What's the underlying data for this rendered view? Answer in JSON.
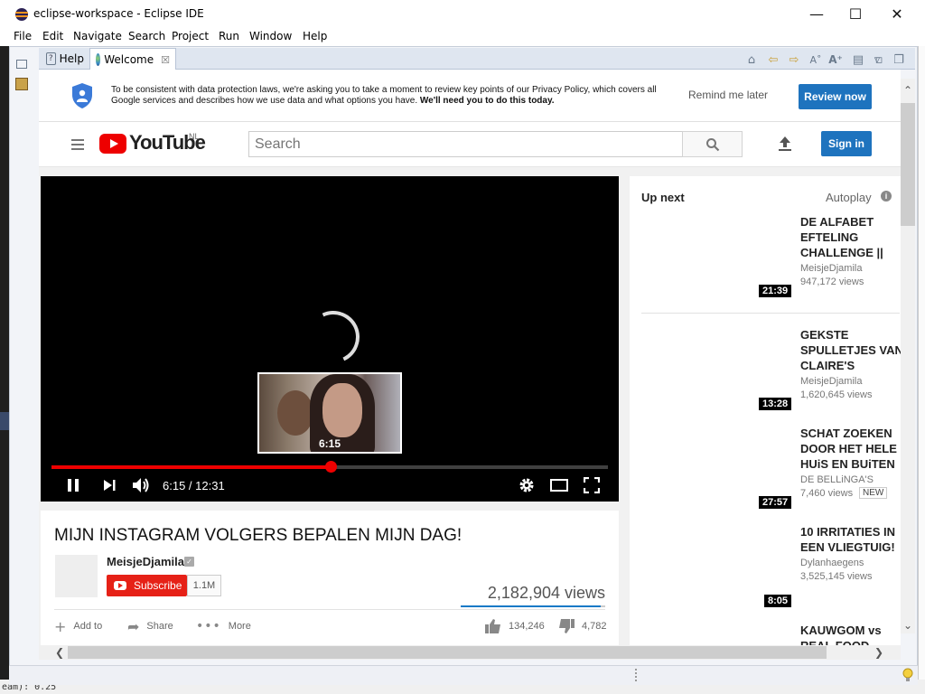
{
  "window": {
    "title": "eclipse-workspace - Eclipse IDE",
    "minimize": "—",
    "maximize": "☐",
    "close": "✕"
  },
  "menu": [
    "File",
    "Edit",
    "Navigate",
    "Search",
    "Project",
    "Run",
    "Window",
    "Help"
  ],
  "tabs": {
    "help": "Help",
    "welcome": "Welcome",
    "welcome_close": "☒"
  },
  "banner": {
    "text_plain": "To be consistent with data protection laws, we're asking you to take a moment to review key points of our Privacy Policy, which covers all Google services and describes how we use data and what options you have.",
    "text_bold": "We'll need you to do this today.",
    "remind": "Remind me later",
    "review": "Review now"
  },
  "header": {
    "logo_text": "YouTube",
    "region": "NL",
    "search_placeholder": "Search",
    "sign_in": "Sign in"
  },
  "player": {
    "preview_time": "6:15",
    "time_display": "6:15 / 12:31",
    "progress_fraction": 0.502
  },
  "video": {
    "title": "MIJN INSTAGRAM VOLGERS BEPALEN MIJN DAG!",
    "channel": "MeisjeDjamila",
    "subscribe": "Subscribe",
    "subscribers": "1.1M",
    "views": "2,182,904 views",
    "add_to": "Add to",
    "share": "Share",
    "more": "More",
    "likes": "134,246",
    "dislikes": "4,782"
  },
  "sidebar": {
    "up_next": "Up next",
    "autoplay": "Autoplay",
    "items": [
      {
        "title": "DE ALFABET EFTELING CHALLENGE || ABC Challenge",
        "channel": "MeisjeDjamila",
        "views": "947,172 views",
        "duration": "21:39",
        "badge": ""
      },
      {
        "title": "GEKSTE SPULLETJES VAN CLAIRE'S UITPROBEREN! || Meisje",
        "channel": "MeisjeDjamila",
        "views": "1,620,645 views",
        "duration": "13:28",
        "badge": ""
      },
      {
        "title": "SCHAT ZOEKEN DOOR HET HELE HUiS EN BUiTEN 🗺 | Bellinga",
        "channel": "DE BELLiNGA'S",
        "views": "7,460 views",
        "duration": "27:57",
        "badge": "NEW"
      },
      {
        "title": "10 IRRITATIES IN EEN VLIEGTUIG!",
        "channel": "Dylanhaegens",
        "views": "3,525,145 views",
        "duration": "8:05",
        "badge": ""
      },
      {
        "title": "KAUWGOM vs REAL FOOD CHALLENGE",
        "channel": "",
        "views": "",
        "duration": "",
        "badge": ""
      }
    ]
  },
  "background": {
    "bottom_text": "eam): 0.25"
  },
  "colors": {
    "yt_red": "#e62117",
    "signin_blue": "#1e73be",
    "progress_red": "#ee0000"
  }
}
